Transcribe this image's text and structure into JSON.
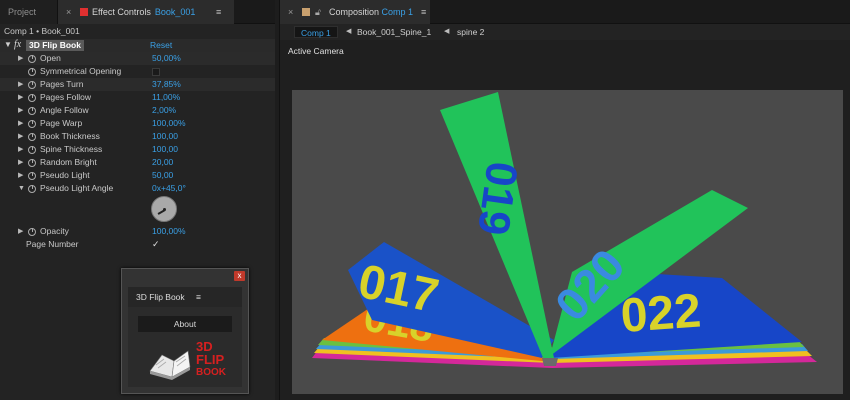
{
  "left_panel": {
    "tabs": {
      "project": "Project",
      "effect_controls": "Effect Controls",
      "effect_controls_subject": "Book_001"
    },
    "comp_path": "Comp 1 • Book_001",
    "effect": {
      "fx": "fx",
      "name": "3D Flip Book",
      "reset": "Reset"
    },
    "params": [
      {
        "label": "Open",
        "value": "50,00%"
      },
      {
        "label": "Symmetrical Opening",
        "value": ""
      },
      {
        "label": "Pages Turn",
        "value": "37,85%"
      },
      {
        "label": "Pages Follow",
        "value": "11,00%"
      },
      {
        "label": "Angle Follow",
        "value": "2,00%"
      },
      {
        "label": "Page Warp",
        "value": "100,00%"
      },
      {
        "label": "Book Thickness",
        "value": "100,00"
      },
      {
        "label": "Spine Thickness",
        "value": "100,00"
      },
      {
        "label": "Random Bright",
        "value": "20,00"
      },
      {
        "label": "Pseudo Light",
        "value": "50,00"
      },
      {
        "label": "Pseudo Light Angle",
        "value": "0x+45,0°"
      },
      {
        "label": "Opacity",
        "value": "100,00%"
      },
      {
        "label": "Page Number",
        "value": "✓"
      }
    ],
    "floating_window": {
      "close": "x",
      "title": "3D Flip Book",
      "about_button": "About",
      "logo_text": {
        "line1": "3D",
        "line2": "FLIP",
        "line3": "BOOK"
      }
    }
  },
  "composition": {
    "tab_label": "Composition",
    "tab_subject": "Comp 1",
    "breadcrumbs": [
      "Comp 1",
      "Book_001_Spine_1",
      "spine 2"
    ],
    "viewer_label": "Active Camera",
    "book_numbers": {
      "left_page": "017",
      "left_under": "018",
      "turning_page": "019",
      "turning_page_2": "020",
      "right_page": "022"
    }
  },
  "menu_glyph": "≡",
  "close_glyph": "×",
  "colors": {
    "accent_blue": "#3aa0e6",
    "effect_tab_square": "#e03030",
    "comp_tab_square": "#c8a06e",
    "page_blue": "#1746c8",
    "page_green": "#21c35a",
    "page_orange": "#ee7010",
    "number_yellow": "#d8d22a"
  }
}
